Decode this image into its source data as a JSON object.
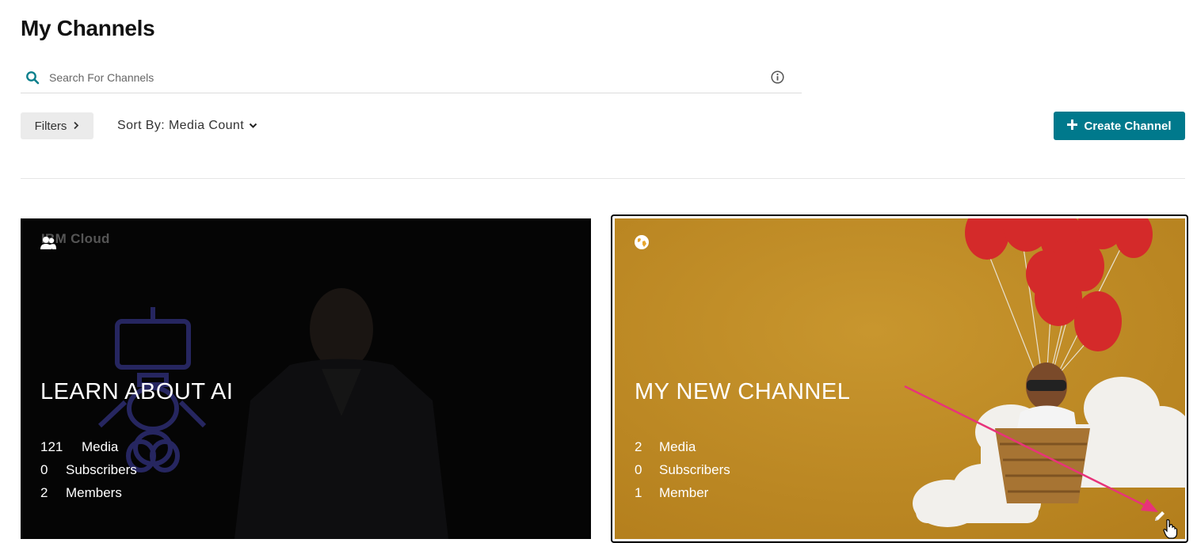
{
  "page": {
    "title": "My Channels"
  },
  "search": {
    "placeholder": "Search For Channels",
    "value": ""
  },
  "toolbar": {
    "filters_label": "Filters",
    "sort_label": "Sort By: Media Count",
    "create_label": "Create Channel"
  },
  "colors": {
    "accent": "#00798c",
    "search_icon": "#0a7f8c",
    "annotation_arrow": "#e8337a"
  },
  "channels": [
    {
      "title": "LEARN ABOUT AI",
      "watermark": "IBM Cloud",
      "type_icon": "group-icon",
      "stats": [
        {
          "count": "121",
          "label": "Media"
        },
        {
          "count": "0",
          "label": "Subscribers"
        },
        {
          "count": "2",
          "label": "Members"
        }
      ]
    },
    {
      "title": "MY NEW CHANNEL",
      "type_icon": "globe-icon",
      "stats": [
        {
          "count": "2",
          "label": "Media"
        },
        {
          "count": "0",
          "label": "Subscribers"
        },
        {
          "count": "1",
          "label": "Member"
        }
      ]
    }
  ]
}
